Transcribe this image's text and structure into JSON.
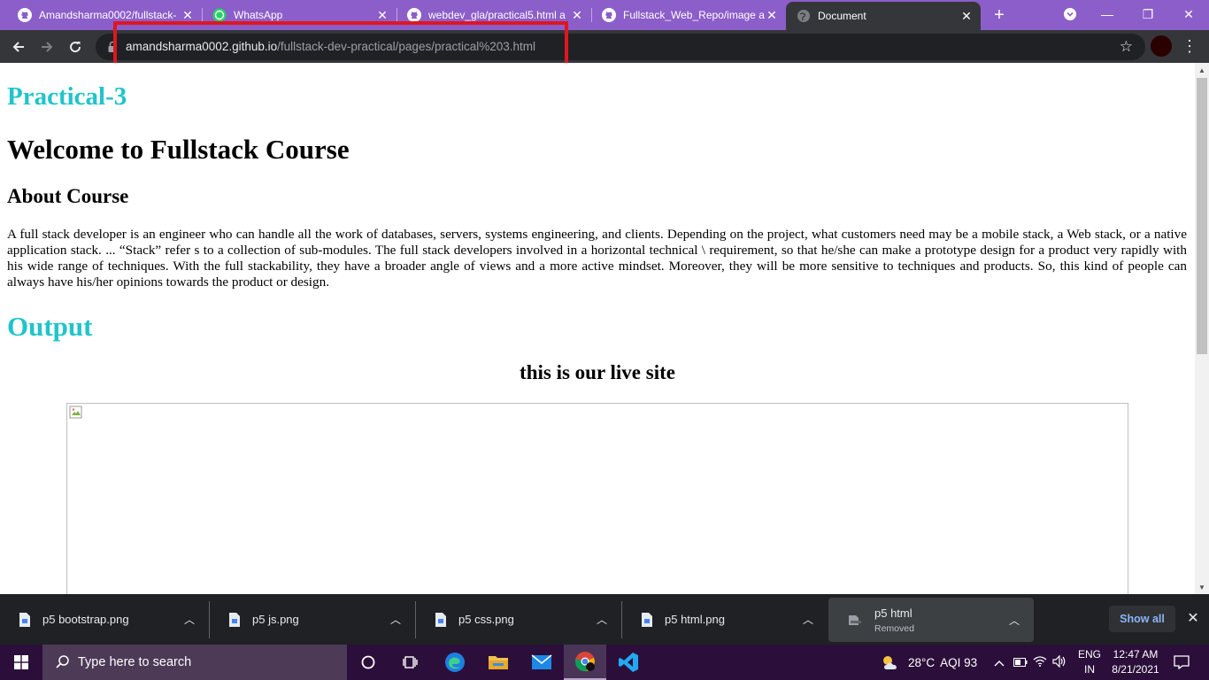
{
  "browser": {
    "tabs": [
      {
        "title": "Amandsharma0002/fullstack-",
        "icon": "github-icon"
      },
      {
        "title": "WhatsApp",
        "icon": "whatsapp-icon"
      },
      {
        "title": "webdev_gla/practical5.html a",
        "icon": "github-icon"
      },
      {
        "title": "Fullstack_Web_Repo/image a",
        "icon": "github-icon"
      },
      {
        "title": "Document",
        "icon": "globe-icon",
        "active": true
      }
    ],
    "url_host": "amandsharma0002.github.io",
    "url_path": "/fullstack-dev-practical/pages/practical%203.html",
    "highlight_color": "#e0161f",
    "accent_color": "#8c5ec9"
  },
  "page": {
    "practical_heading": "Practical-3",
    "welcome_heading": "Welcome to Fullstack Course",
    "about_heading": "About Course",
    "about_text": "A full stack developer is an engineer who can handle all the work of databases, servers, systems engineering, and clients. Depending on the project, what customers need may be a mobile stack, a Web stack, or a native application stack. ... “Stack” refer s to a collection of sub-modules. The full stack developers involved in a horizontal technical \\ requirement, so that he/she can make a prototype design for a product very rapidly with his wide range of techniques. With the full stackability, they have a broader angle of views and a more active mindset. Moreover, they will be more sensitive to techniques and products. So, this kind of people can always have his/her opinions towards the product or design.",
    "output_heading": "Output",
    "live_site_caption": "this is our live site",
    "heading_color": "#1fc4cc"
  },
  "downloads": {
    "items": [
      {
        "name": "p5 bootstrap.png"
      },
      {
        "name": "p5 js.png"
      },
      {
        "name": "p5  css.png"
      },
      {
        "name": "p5 html.png"
      },
      {
        "name": "p5 html",
        "status": "Removed"
      }
    ],
    "show_all_label": "Show all"
  },
  "taskbar": {
    "search_placeholder": "Type here to search",
    "weather": "28°C",
    "aqi": "AQI 93",
    "lang_top": "ENG",
    "lang_bottom": "IN",
    "time": "12:47 AM",
    "date": "8/21/2021"
  }
}
